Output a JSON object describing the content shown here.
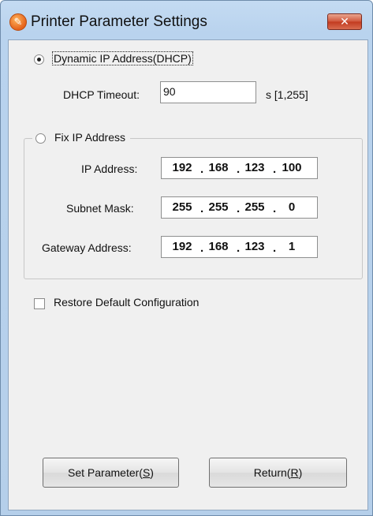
{
  "window": {
    "title": "Printer Parameter Settings",
    "close_glyph": "✕",
    "app_icon": "wrench-icon"
  },
  "dhcp": {
    "label": "Dynamic IP Address(DHCP)",
    "selected": true,
    "timeout_label": "DHCP Timeout:",
    "timeout_value": "90",
    "timeout_unit": "s [1,255]"
  },
  "fixed_ip": {
    "label": "Fix IP Address",
    "selected": false,
    "ip_label": "IP Address:",
    "ip": [
      "192",
      "168",
      "123",
      "100"
    ],
    "subnet_label": "Subnet Mask:",
    "subnet": [
      "255",
      "255",
      "255",
      "0"
    ],
    "gateway_label": "Gateway Address:",
    "gateway": [
      "192",
      "168",
      "123",
      "1"
    ]
  },
  "restore_default": {
    "label": "Restore Default Configuration",
    "checked": false
  },
  "buttons": {
    "set_pre": "Set Parameter(",
    "set_key": "S",
    "set_post": ")",
    "return_pre": "Return(",
    "return_key": "R",
    "return_post": ")"
  },
  "colors": {
    "title_bar": "#b9d3ee",
    "close_button": "#c23a1f",
    "dialog_face": "#f0f0f0"
  }
}
